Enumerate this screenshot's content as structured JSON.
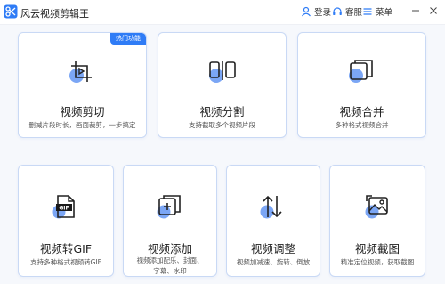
{
  "app": {
    "title": "风云视频剪辑王",
    "login_label": "登录",
    "service_label": "客服",
    "menu_label": "菜单"
  },
  "colors": {
    "accent": "#2f7cf6",
    "icon_circle": "#7ba6f5",
    "icon_stroke": "#222222",
    "card_border": "#c9d9f5"
  },
  "features": [
    {
      "title": "视频剪切",
      "desc": "删减片段时长，画面裁剪，一步搞定",
      "badge": "热门功能",
      "icon": "video-cut-icon"
    },
    {
      "title": "视频分割",
      "desc": "支持截取多个视频片段",
      "icon": "video-split-icon"
    },
    {
      "title": "视频合并",
      "desc": "多种格式视频合并",
      "icon": "video-merge-icon"
    },
    {
      "title": "视频转GIF",
      "desc": "支持多种格式视频转GIF",
      "icon": "gif-convert-icon"
    },
    {
      "title": "视频添加",
      "desc_line1": "视频添加配乐、封面、",
      "desc_line2": "字幕、水印",
      "icon": "video-add-icon"
    },
    {
      "title": "视频调整",
      "desc": "视频加减速、旋转、倒放",
      "icon": "video-adjust-icon"
    },
    {
      "title": "视频截图",
      "desc": "精准定位视频，获取截图",
      "icon": "video-screenshot-icon"
    }
  ]
}
